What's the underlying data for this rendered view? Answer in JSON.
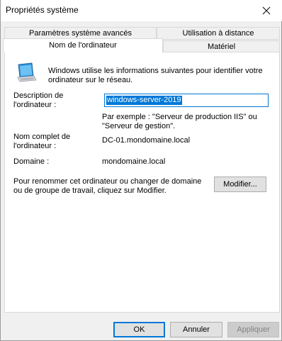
{
  "window": {
    "title": "Propriétés système"
  },
  "tabs": {
    "row1": [
      "Paramètres système avancés",
      "Utilisation à distance"
    ],
    "row2": [
      "Nom de l'ordinateur",
      "Matériel"
    ],
    "active": "Nom de l'ordinateur"
  },
  "panel": {
    "intro": [
      "Windows utilise les informations suivantes pour identifier votre",
      "ordinateur sur le réseau."
    ],
    "description_label": [
      "Description de",
      "l'ordinateur :"
    ],
    "description_value": "windows-server-2019",
    "example": [
      "Par exemple : \"Serveur de production IIS\" ou",
      "\"Serveur de gestion\"."
    ],
    "fullname_label": [
      "Nom complet de",
      "l'ordinateur :"
    ],
    "fullname_value": "DC-01.mondomaine.local",
    "domain_label": "Domaine :",
    "domain_value": "mondomaine.local",
    "rename_text": [
      "Pour renommer cet ordinateur ou changer de domaine",
      "ou de groupe de travail, cliquez sur Modifier."
    ],
    "modify_button": "Modifier..."
  },
  "footer": {
    "ok": "OK",
    "cancel": "Annuler",
    "apply": "Appliquer"
  },
  "icons": {
    "close": "close-icon",
    "computer": "computer-icon"
  }
}
